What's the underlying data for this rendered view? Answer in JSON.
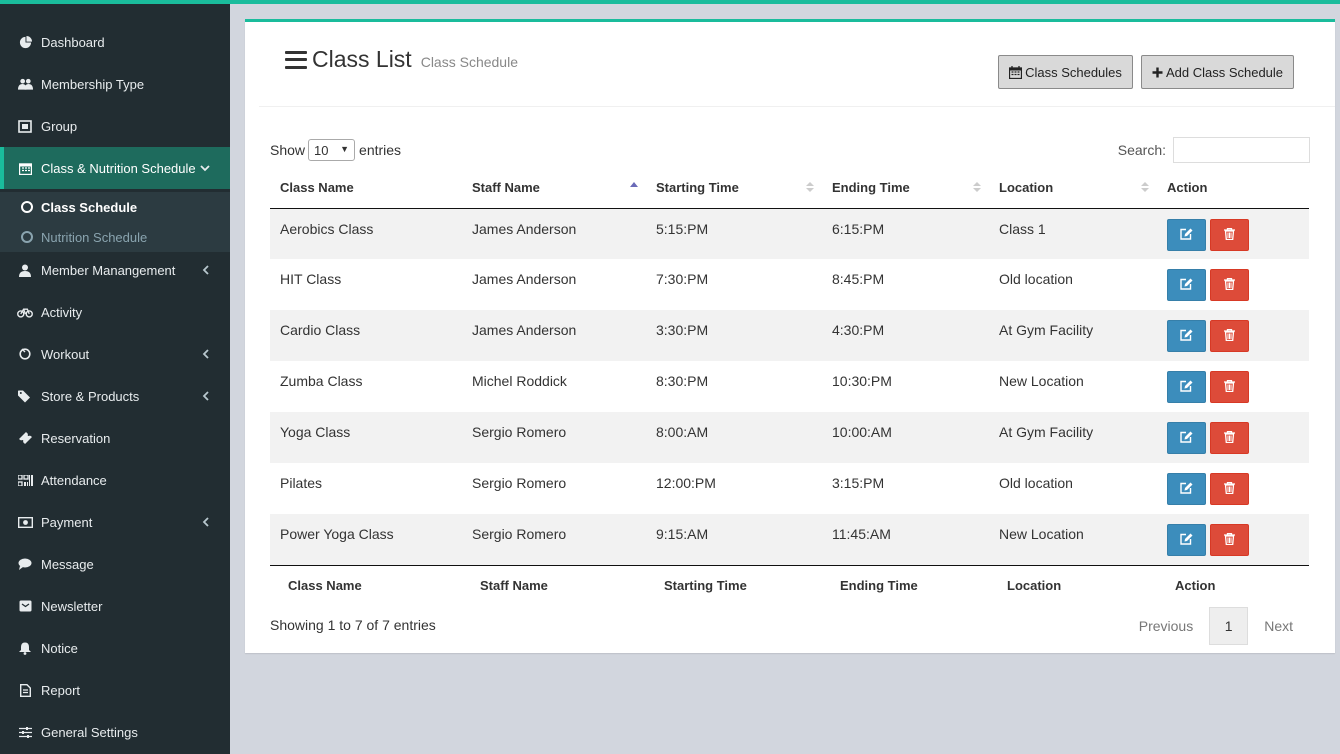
{
  "colors": {
    "sidebar": "#222d32",
    "accent": "#1abc9c",
    "edit": "#3c8dbc",
    "delete": "#dd4b39"
  },
  "sidebar": {
    "items": [
      {
        "label": "Dashboard",
        "icon": "dashboard-icon"
      },
      {
        "label": "Membership Type",
        "icon": "users-icon"
      },
      {
        "label": "Group",
        "icon": "group-icon"
      },
      {
        "label": "Class & Nutrition Schedule",
        "icon": "calendar-icon"
      },
      {
        "label": "Member Manangement",
        "icon": "user-icon"
      },
      {
        "label": "Activity",
        "icon": "bicycle-icon"
      },
      {
        "label": "Workout",
        "icon": "workout-icon"
      },
      {
        "label": "Store & Products",
        "icon": "tags-icon"
      },
      {
        "label": "Reservation",
        "icon": "ticket-icon"
      },
      {
        "label": "Attendance",
        "icon": "qrcode-icon"
      },
      {
        "label": "Payment",
        "icon": "money-icon"
      },
      {
        "label": "Message",
        "icon": "comment-icon"
      },
      {
        "label": "Newsletter",
        "icon": "envelope-icon"
      },
      {
        "label": "Notice",
        "icon": "bell-icon"
      },
      {
        "label": "Report",
        "icon": "file-icon"
      },
      {
        "label": "General Settings",
        "icon": "sliders-icon"
      }
    ],
    "submenu": [
      {
        "label": "Class Schedule"
      },
      {
        "label": "Nutrition Schedule"
      }
    ]
  },
  "header": {
    "title": "Class List",
    "subtitle": "Class Schedule",
    "btn_schedules": "Class Schedules",
    "btn_add": "Add Class Schedule"
  },
  "controls": {
    "show_label": "Show",
    "page_size": "10",
    "entries_label": "entries",
    "search_label": "Search:",
    "search_value": ""
  },
  "table": {
    "columns": [
      "Class Name",
      "Staff Name",
      "Starting Time",
      "Ending Time",
      "Location",
      "Action"
    ],
    "rows": [
      [
        "Aerobics Class",
        "James Anderson",
        "5:15:PM",
        "6:15:PM",
        "Class 1"
      ],
      [
        "HIT Class",
        "James Anderson",
        "7:30:PM",
        "8:45:PM",
        "Old location"
      ],
      [
        "Cardio Class",
        "James Anderson",
        "3:30:PM",
        "4:30:PM",
        "At Gym Facility"
      ],
      [
        "Zumba Class",
        "Michel Roddick",
        "8:30:PM",
        "10:30:PM",
        "New Location"
      ],
      [
        "Yoga Class",
        "Sergio Romero",
        "8:00:AM",
        "10:00:AM",
        "At Gym Facility"
      ],
      [
        "Pilates",
        "Sergio Romero",
        "12:00:PM",
        "3:15:PM",
        "Old location"
      ],
      [
        "Power Yoga Class",
        "Sergio Romero",
        "9:15:AM",
        "11:45:AM",
        "New Location"
      ]
    ]
  },
  "footer": {
    "info": "Showing 1 to 7 of 7 entries",
    "prev": "Previous",
    "page": "1",
    "next": "Next"
  }
}
